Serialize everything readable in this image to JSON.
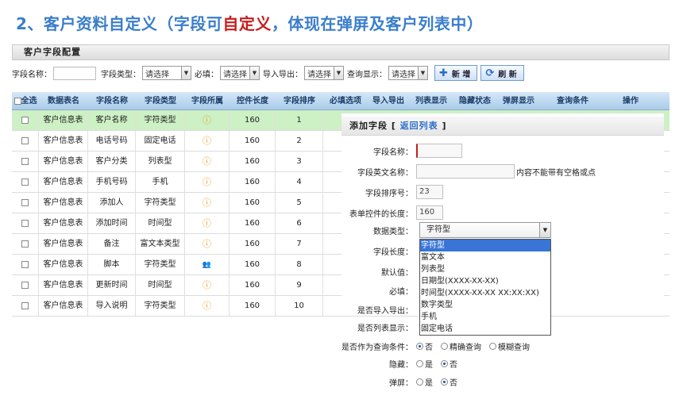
{
  "heading": {
    "prefix": "2、客户资料自定义（字段可",
    "highlight": "自定义",
    "suffix": "，体现在弹屏及客户列表中）"
  },
  "panel_title": "客户字段配置",
  "filters": {
    "name_label": "字段名称：",
    "type_label": "字段类型：",
    "type_value": "请选择",
    "required_label": "必填：",
    "required_value": "请选择",
    "import_label": "导入导出：",
    "import_value": "请选择",
    "query_label": "查询显示：",
    "query_value": "请选择",
    "add_label": "新 增",
    "refresh_label": "刷 新"
  },
  "table": {
    "headers": [
      "全选",
      "数据表名",
      "字段名称",
      "字段类型",
      "字段所属",
      "控件长度",
      "字段排序",
      "必填选项",
      "导入导出",
      "列表显示",
      "隐藏状态",
      "弹屏显示",
      "查询条件",
      "操作"
    ],
    "rows": [
      {
        "table": "客户信息表",
        "name": "客户名称",
        "type": "字符类型",
        "owner": "info",
        "len": "160",
        "order": "1"
      },
      {
        "table": "客户信息表",
        "name": "电话号码",
        "type": "固定电话",
        "owner": "info",
        "len": "160",
        "order": "2"
      },
      {
        "table": "客户信息表",
        "name": "客户分类",
        "type": "列表型",
        "owner": "info",
        "len": "160",
        "order": "3"
      },
      {
        "table": "客户信息表",
        "name": "手机号码",
        "type": "手机",
        "owner": "info",
        "len": "160",
        "order": "4"
      },
      {
        "table": "客户信息表",
        "name": "添加人",
        "type": "字符类型",
        "owner": "info",
        "len": "160",
        "order": "5"
      },
      {
        "table": "客户信息表",
        "name": "添加时间",
        "type": "时间型",
        "owner": "info",
        "len": "160",
        "order": "6"
      },
      {
        "table": "客户信息表",
        "name": "备注",
        "type": "富文本类型",
        "owner": "info",
        "len": "160",
        "order": "7"
      },
      {
        "table": "客户信息表",
        "name": "脚本",
        "type": "字符类型",
        "owner": "people",
        "len": "160",
        "order": "8"
      },
      {
        "table": "客户信息表",
        "name": "更新时间",
        "type": "时间型",
        "owner": "info",
        "len": "160",
        "order": "9"
      },
      {
        "table": "客户信息表",
        "name": "导入说明",
        "type": "字符类型",
        "owner": "info",
        "len": "160",
        "order": "10"
      }
    ]
  },
  "popup": {
    "title": "添加字段",
    "back": "返回列表",
    "name_label": "字段名称：",
    "en_name_label": "字段英文名称：",
    "en_name_hint": "内容不能带有空格或点",
    "order_label": "字段排序号：",
    "order_value": "23",
    "width_label": "表单控件的长度：",
    "width_value": "160",
    "dtype_label": "数据类型：",
    "dtype_value": "字符型",
    "len_label": "字段长度：",
    "default_label": "默认值：",
    "required_label": "必填：",
    "import_label": "是否导入导出：",
    "list_label": "是否列表显示：",
    "query_label": "是否作为查询条件：",
    "query_options": [
      "否",
      "精确查询",
      "模糊查询"
    ],
    "hidden_label": "隐藏：",
    "popup_label": "弹屏：",
    "yes": "是",
    "no": "否",
    "dtype_options": [
      "字符型",
      "富文本",
      "列表型",
      "日期型(XXXX-XX-XX)",
      "时间型(XXXX-XX-XX XX:XX:XX)",
      "数字类型",
      "手机",
      "固定电话"
    ]
  }
}
